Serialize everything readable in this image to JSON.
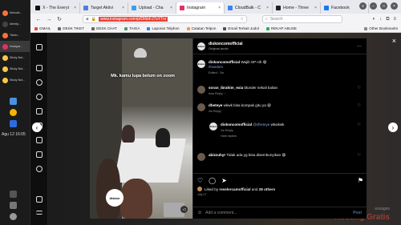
{
  "taskbar": {
    "items": [
      {
        "label": "Mokusit...",
        "color": "#ff7139"
      },
      {
        "label": "Ideretp...",
        "color": "#2b2b2b"
      },
      {
        "label": "Tiketn...",
        "color": "#ff7139"
      },
      {
        "label": "Instagra...",
        "color": "#e1306c"
      },
      {
        "label": "Sticky Not...",
        "color": "#f7c948"
      },
      {
        "label": "Sticky Not...",
        "color": "#f7c948"
      },
      {
        "label": "Sticky Not...",
        "color": "#f7c948"
      }
    ],
    "clock": "Agu 12  16:05"
  },
  "tabs": [
    {
      "label": "X - The Everyt",
      "color": "#111"
    },
    {
      "label": "Target Aktivi",
      "color": "#4f7fd8"
    },
    {
      "label": "Upload - Cha",
      "color": "#3aa0e8"
    },
    {
      "label": "Instagram",
      "color": "#e1306c",
      "active": true
    },
    {
      "label": "CloudBalk - C",
      "color": "#3b82f6"
    },
    {
      "label": "Home - Three",
      "color": "#222"
    },
    {
      "label": "Facebook",
      "color": "#1877f2"
    }
  ],
  "navbar": {
    "url": "www.instagram.com/p/DI6bFJ7sYTn/",
    "search_placeholder": "Search"
  },
  "bookmarks": [
    {
      "label": "GMAIL",
      "color": "#ea4335"
    },
    {
      "label": "DESK TIKET",
      "color": "#555"
    },
    {
      "label": "DESK CHAT",
      "color": "#555"
    },
    {
      "label": "TAIGA",
      "color": "#4c9a6a"
    },
    {
      "label": "Laporan Telphon",
      "color": "#2f80ed"
    },
    {
      "label": "Catatan Telpon",
      "color": "#f2994a"
    },
    {
      "label": "Email Terkait Judol",
      "color": "#4f4f4f"
    },
    {
      "label": "REKAP ABUSE",
      "color": "#27ae60"
    }
  ],
  "bookmarks_other": "Other Bookmarks",
  "post": {
    "overlay_caption": "Mk. kamu lupa belum on zoom",
    "watermark": "diskon",
    "author": "diskoncomofficial",
    "audio": "Original audio",
    "more_icon": "more-icon",
    "caption": "Wajib SP nih 😆",
    "hashtag": "#random",
    "caption_meta": "Edited · 2w",
    "comments": [
      {
        "user": "soran_ibrahim_exia",
        "text": "blunder sekali kalian",
        "meta": "how  Reply  ···"
      },
      {
        "user": "dheteye",
        "text": "wkwk bisa kompak gitu ya 😆",
        "meta": "2w  Reply"
      },
      {
        "user": "diskoncomofficial",
        "mention": "@dheteye",
        "text": "wkwkwk",
        "meta": "1w  Reply",
        "extra": "Hide replies"
      },
      {
        "user": "abizzuhyr",
        "text": "Tidak ada yg bisa disembunyikan 😆",
        "meta": ""
      }
    ],
    "likes_user": "reselercamofficial",
    "likes_others": "28 others",
    "likes_prefix": "Liked by",
    "likes_and": "and",
    "date": "July 27",
    "add_placeholder": "Add a comment...",
    "post_button": "Post"
  },
  "background": {
    "right_text": "Hosting Gratis",
    "right_subtext": "essages"
  }
}
